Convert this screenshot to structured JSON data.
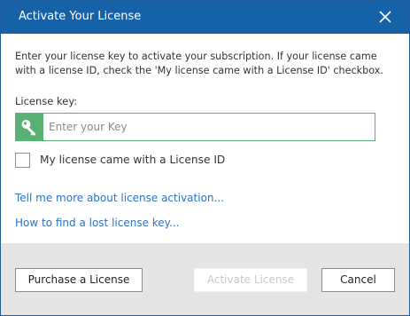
{
  "dialog": {
    "title": "Activate Your License",
    "intro_text": "Enter your license key to activate your subscription. If your license came with a license ID, check the 'My license came with a License ID' checkbox.",
    "license_key": {
      "label": "License key:",
      "value": "",
      "placeholder": "Enter your Key"
    },
    "license_id_checkbox": {
      "label": "My license came with a License ID",
      "checked": false
    },
    "links": {
      "license_activation": "Tell me more about license activation...",
      "lost_key": "How to find a lost license key..."
    },
    "buttons": {
      "purchase": "Purchase a License",
      "activate": "Activate License",
      "cancel": "Cancel"
    }
  },
  "colors": {
    "titlebar": "#1662a8",
    "accent_green": "#58b072",
    "link": "#2a73c4",
    "footer": "#e4e4e4"
  },
  "icons": {
    "close": "close-icon",
    "key": "key-icon"
  }
}
